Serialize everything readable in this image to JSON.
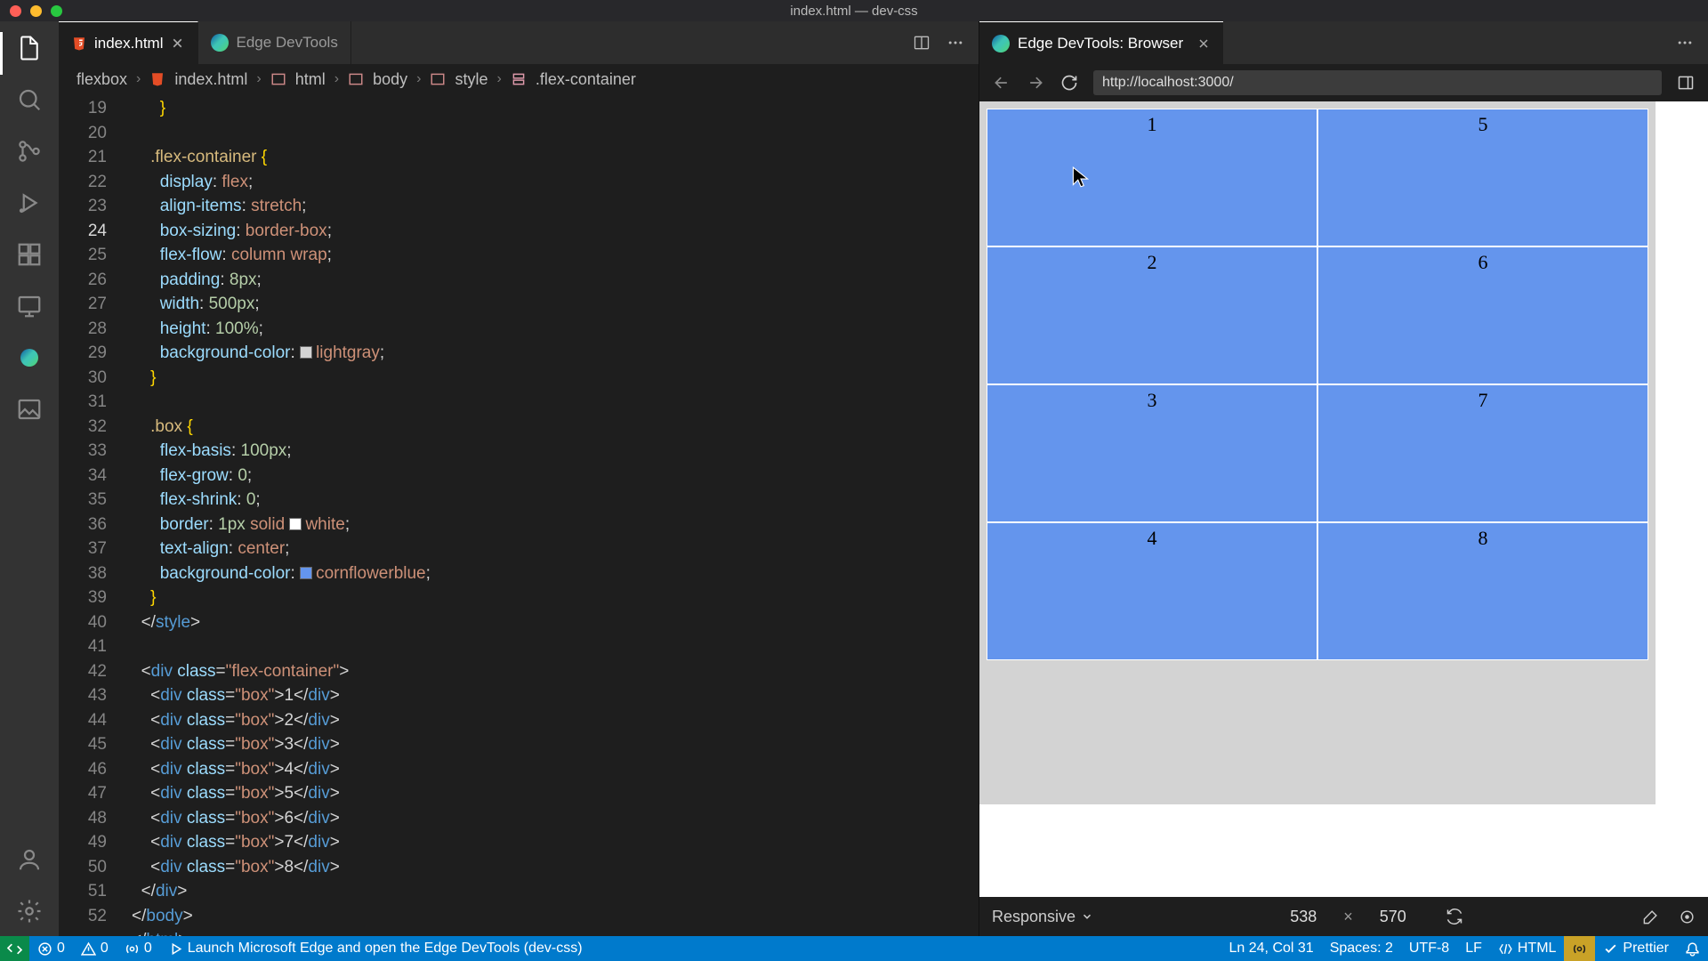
{
  "window_title": "index.html — dev-css",
  "tabs": [
    {
      "label": "index.html",
      "active": true,
      "close": true
    },
    {
      "label": "Edge DevTools",
      "active": false,
      "close": false
    }
  ],
  "right_tab": {
    "label": "Edge DevTools: Browser"
  },
  "breadcrumbs": [
    "flexbox",
    "index.html",
    "html",
    "body",
    "style",
    ".flex-container"
  ],
  "url": "http://localhost:3000/",
  "responsive_label": "Responsive",
  "viewport": {
    "w": "538",
    "h": "570"
  },
  "status": {
    "errors": "0",
    "warnings": "0",
    "port_fwd": "0",
    "launch_hint": "Launch Microsoft Edge and open the Edge DevTools (dev-css)",
    "cursor": "Ln 24, Col 31",
    "spaces": "Spaces: 2",
    "encoding": "UTF-8",
    "eol": "LF",
    "lang": "HTML",
    "prettier": "Prettier"
  },
  "line_start": 19,
  "current_line": 24,
  "colors": {
    "lightgray": "#d3d3d3",
    "white": "#ffffff",
    "cornflowerblue": "#6495ed"
  },
  "code": {
    "l20": {
      "sel": ".flex-container"
    },
    "l21": {
      "p": "display",
      "v": "flex"
    },
    "l22": {
      "p": "align-items",
      "v": "stretch"
    },
    "l23": {
      "p": "box-sizing",
      "v": "border-box"
    },
    "l24": {
      "p": "flex-flow",
      "v": "column wrap"
    },
    "l25": {
      "p": "padding",
      "v": "8px"
    },
    "l26": {
      "p": "width",
      "v": "500px"
    },
    "l27": {
      "p": "height",
      "v": "100%"
    },
    "l28": {
      "p": "background-color",
      "v": "lightgray"
    },
    "l31": {
      "sel": ".box"
    },
    "l32": {
      "p": "flex-basis",
      "v": "100px"
    },
    "l33": {
      "p": "flex-grow",
      "v": "0"
    },
    "l34": {
      "p": "flex-shrink",
      "v": "0"
    },
    "l35": {
      "p": "border",
      "v1": "1px",
      "v2": "solid",
      "v3": "white"
    },
    "l36": {
      "p": "text-align",
      "v": "center"
    },
    "l37": {
      "p": "background-color",
      "v": "cornflowerblue"
    },
    "style_close": "style",
    "div_open": {
      "tag": "div",
      "attr": "class",
      "val": "flex-container"
    },
    "boxdiv": {
      "tag": "div",
      "attr": "class",
      "val": "box"
    },
    "boxnums": [
      "1",
      "2",
      "3",
      "4",
      "5",
      "6",
      "7",
      "8"
    ],
    "div_close": "div",
    "body_close": "body",
    "html_close": "html"
  },
  "preview_boxes": [
    "1",
    "2",
    "3",
    "4",
    "5",
    "6",
    "7",
    "8"
  ]
}
